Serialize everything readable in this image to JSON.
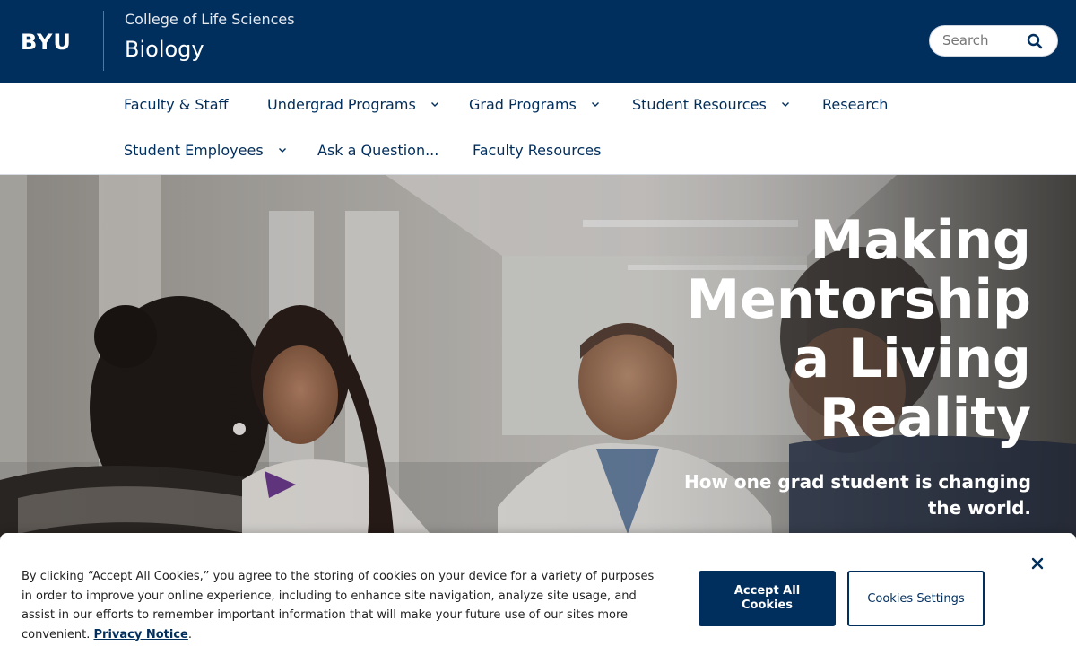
{
  "header": {
    "logo_text": "BYU",
    "college": "College of Life Sciences",
    "department": "Biology",
    "search_placeholder": "Search",
    "brand_color": "#002e5d"
  },
  "nav": {
    "items": [
      {
        "label": "Faculty & Staff",
        "has_dropdown": false
      },
      {
        "label": "Undergrad Programs",
        "has_dropdown": true
      },
      {
        "label": "Grad Programs",
        "has_dropdown": true
      },
      {
        "label": "Student Resources",
        "has_dropdown": true
      },
      {
        "label": "Research",
        "has_dropdown": false
      },
      {
        "label": "Student Employees",
        "has_dropdown": true
      },
      {
        "label": "Ask a Question...",
        "has_dropdown": false
      },
      {
        "label": "Faculty Resources",
        "has_dropdown": false
      }
    ]
  },
  "hero": {
    "title": "Making Mentorship a Living Reality",
    "subtitle": "How one grad student is changing the world."
  },
  "cookie_banner": {
    "text": "By clicking “Accept All Cookies,” you agree to the storing of cookies on your device for a variety of purposes in order to improve your online experience, including to enhance site navigation, analyze site usage, and assist in our efforts to remember important information that will make your future use of our sites more convenient.",
    "privacy_link": "Privacy Notice",
    "period": ".",
    "accept_label": "Accept All Cookies",
    "settings_label": "Cookies Settings"
  },
  "icons": {
    "search": "search-icon",
    "chevron": "chevron-down-icon",
    "close": "close-icon"
  }
}
